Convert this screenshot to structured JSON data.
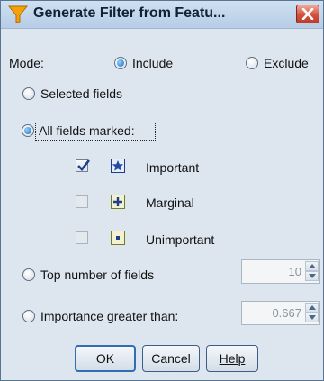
{
  "window": {
    "title": "Generate Filter from Featu..."
  },
  "mode": {
    "label": "Mode:",
    "include_label": "Include",
    "exclude_label": "Exclude",
    "selected": "include"
  },
  "selection": {
    "selected_fields_label": "Selected fields",
    "all_fields_marked_label": "All fields marked:",
    "selected": "all_fields_marked"
  },
  "importance": [
    {
      "label": "Important",
      "checked": true,
      "icon": "star-icon"
    },
    {
      "label": "Marginal",
      "checked": false,
      "icon": "plus-icon"
    },
    {
      "label": "Unimportant",
      "checked": false,
      "icon": "dot-icon"
    }
  ],
  "top_number": {
    "label": "Top number of fields",
    "value": "10"
  },
  "importance_greater": {
    "label": "Importance greater than:",
    "value": "0.667"
  },
  "buttons": {
    "ok": "OK",
    "cancel": "Cancel",
    "help": "Help"
  },
  "colors": {
    "accent": "#2f6db5",
    "background": "#dde6ef",
    "close": "#d4513f"
  }
}
